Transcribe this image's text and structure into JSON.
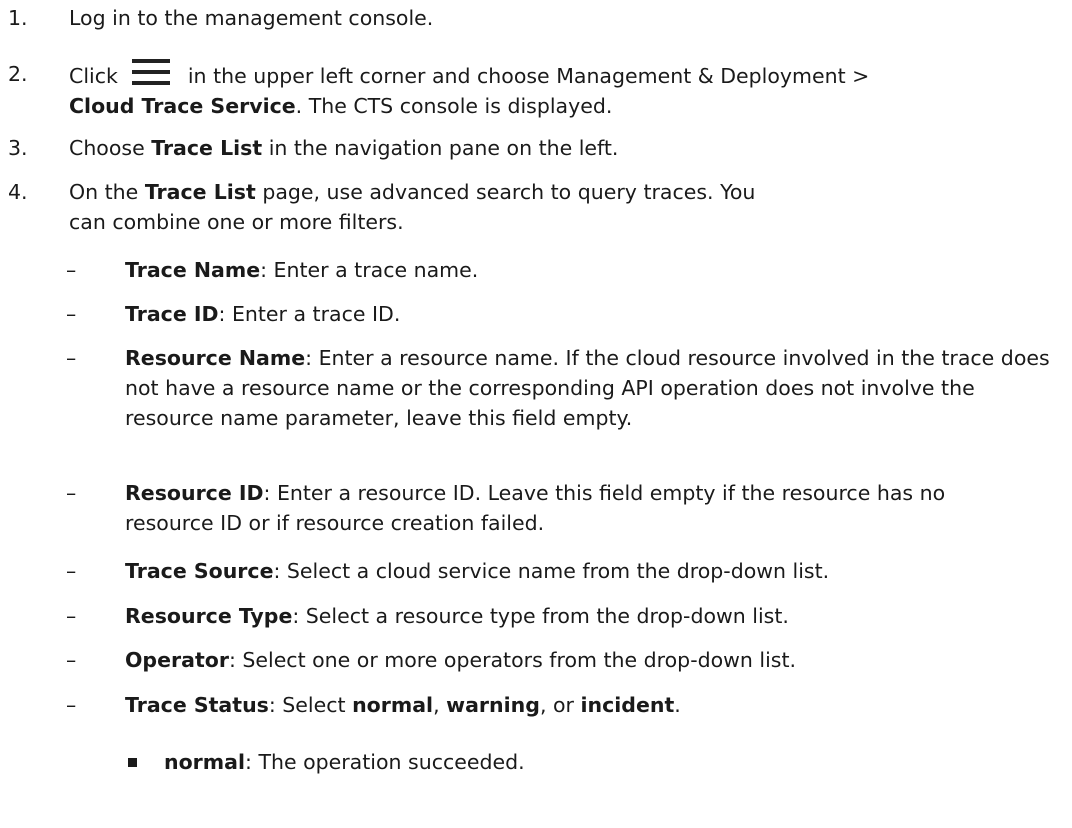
{
  "steps": [
    {
      "num": "1.",
      "text": "Log in to the management console."
    },
    {
      "num": "2.",
      "pre": "Click",
      "icon": "menu-icon",
      "mid": "in the upper left corner and choose Management & Deployment >",
      "bold": "Cloud Trace Service",
      "post": ". The CTS console is displayed."
    },
    {
      "num": "3.",
      "pre": "Choose",
      "bold": "Trace List",
      "post": "in the navigation pane on the left."
    },
    {
      "num": "4.",
      "pre": "On the",
      "bold": "Trace List",
      "post": "page, use advanced search to query traces. You can combine one or more filters."
    }
  ],
  "filters": [
    {
      "dash": "–",
      "label": "Trace Name",
      "desc": ": Enter a trace name."
    },
    {
      "dash": "–",
      "label": "Trace ID",
      "desc": ": Enter a trace ID."
    },
    {
      "dash": "–",
      "label": "Resource Name",
      "desc": ": Enter a resource name. If the cloud resource involved in the trace does not have a resource name or the corresponding API operation does not involve the resource name parameter, leave this field empty."
    },
    {
      "dash": "–",
      "label": "Resource ID",
      "desc": ": Enter a resource ID. Leave this field empty if the resource has no resource ID or if resource creation failed."
    },
    {
      "dash": "–",
      "label": "Trace Source",
      "desc": ": Select a cloud service name from the drop-down list."
    },
    {
      "dash": "–",
      "label": "Resource Type",
      "desc": ": Select a resource type from the drop-down list."
    },
    {
      "dash": "–",
      "label": "Operator",
      "desc": ": Select one or more operators from the drop-down list."
    },
    {
      "dash": "–",
      "label": "Trace Status",
      "desc": ": Select",
      "opt1": "normal",
      "sep1": ",",
      "opt2": "warning",
      "sep2": ", or",
      "opt3": "incident",
      "end": "."
    }
  ],
  "status_items": [
    {
      "label": "normal",
      "desc": ": The operation succeeded."
    }
  ]
}
